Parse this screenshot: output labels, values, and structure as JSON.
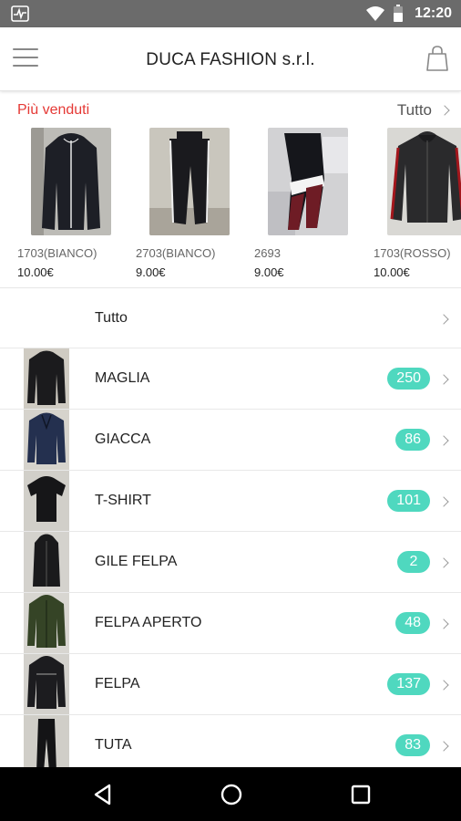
{
  "status_bar": {
    "time": "12:20",
    "icons": [
      "activity-icon",
      "wifi-icon",
      "battery-icon"
    ]
  },
  "app_bar": {
    "title": "DUCA FASHION s.r.l.",
    "menu_icon": "hamburger-menu-icon",
    "cart_icon": "shopping-bag-icon"
  },
  "best_sellers": {
    "title": "Più venduti",
    "view_all": "Tutto",
    "items": [
      {
        "code": "1703(BIANCO)",
        "price": "10.00€"
      },
      {
        "code": "2703(BIANCO)",
        "price": "9.00€"
      },
      {
        "code": "2693",
        "price": "9.00€"
      },
      {
        "code": "1703(ROSSO)",
        "price": "10.00€"
      }
    ]
  },
  "categories": {
    "all_label": "Tutto",
    "items": [
      {
        "label": "MAGLIA",
        "count": "250"
      },
      {
        "label": "GIACCA",
        "count": "86"
      },
      {
        "label": "T-SHIRT",
        "count": "101"
      },
      {
        "label": "GILE FELPA",
        "count": "2"
      },
      {
        "label": "FELPA APERTO",
        "count": "48"
      },
      {
        "label": "FELPA",
        "count": "137"
      },
      {
        "label": "TUTA",
        "count": "83"
      }
    ]
  },
  "colors": {
    "accent_red": "#e53935",
    "badge_teal": "#4fd8bf",
    "status_bar": "#6b6b6b",
    "nav_bar": "#000000"
  },
  "nav_bar": {
    "icons": [
      "back-icon",
      "home-icon",
      "recents-icon"
    ]
  }
}
